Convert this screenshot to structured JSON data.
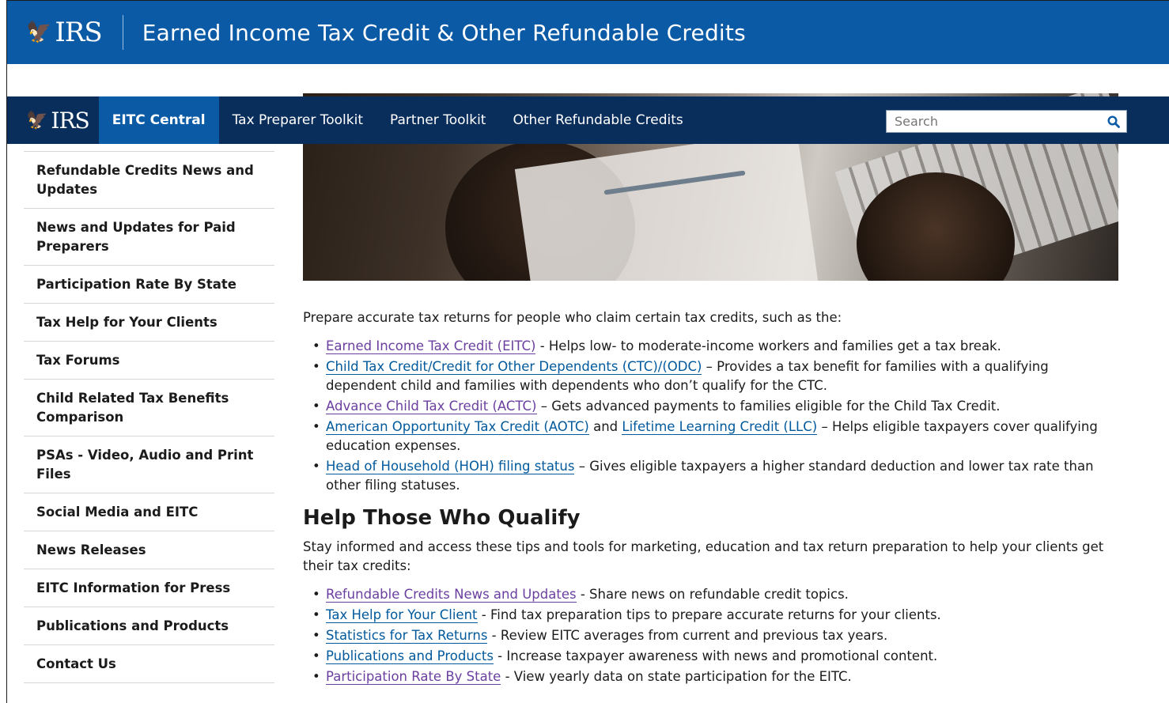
{
  "banner": {
    "logo_text": "IRS",
    "title": "Earned Income Tax Credit & Other Refundable Credits"
  },
  "nav": {
    "logo_text": "IRS",
    "items": [
      {
        "label": "EITC Central",
        "active": true
      },
      {
        "label": "Tax Preparer Toolkit",
        "active": false
      },
      {
        "label": "Partner Toolkit",
        "active": false
      },
      {
        "label": "Other Refundable Credits",
        "active": false
      }
    ],
    "search_placeholder": "Search"
  },
  "sidebar": {
    "items": [
      {
        "label": "Refundable Credits News and Updates"
      },
      {
        "label": "News and Updates for Paid Preparers"
      },
      {
        "label": "Participation Rate By State"
      },
      {
        "label": "Tax Help for Your Clients"
      },
      {
        "label": "Tax Forums"
      },
      {
        "label": "Child Related Tax Benefits Comparison"
      },
      {
        "label": "PSAs - Video, Audio and Print Files"
      },
      {
        "label": "Social Media and EITC"
      },
      {
        "label": "News Releases"
      },
      {
        "label": "EITC Information for Press"
      },
      {
        "label": "Publications and Products"
      },
      {
        "label": "Contact Us"
      }
    ]
  },
  "main": {
    "intro": "Prepare accurate tax returns for people who claim certain tax credits, such as the:",
    "credits": [
      {
        "link": "Earned Income Tax Credit (EITC)",
        "text": " - Helps low- to moderate-income workers and families get a tax break."
      },
      {
        "link": "Child Tax Credit/Credit for Other Dependents (CTC)/(ODC)",
        "text": " – Provides a tax benefit for families with a qualifying dependent child and families with dependents who don’t qualify for the CTC."
      },
      {
        "link": "Advance Child Tax Credit (ACTC)",
        "text": " – Gets advanced payments to families eligible for the Child Tax Credit."
      },
      {
        "link": "American Opportunity Tax Credit (AOTC)",
        "middle": " and ",
        "link2": "Lifetime Learning Credit (LLC)",
        "text": "  – Helps eligible taxpayers cover qualifying education expenses."
      },
      {
        "link": "Head of Household (HOH) filing status",
        "text": " – Gives eligible taxpayers a higher standard deduction and lower tax rate than other filing statuses."
      }
    ],
    "heading": "Help Those Who Qualify",
    "help_intro": "Stay informed and access these tips and tools for marketing, education and tax return preparation to help your clients get their tax credits:",
    "tools": [
      {
        "link": "Refundable Credits News and Updates",
        "text": " - Share news on refundable credit topics."
      },
      {
        "link": "Tax Help for Your Client",
        "text": " - Find tax preparation tips to prepare accurate returns for your clients."
      },
      {
        "link": "Statistics for Tax Returns",
        "text": " - Review EITC averages from current and previous tax years."
      },
      {
        "link": "Publications and Products",
        "text": " - Increase taxpayer awareness with news and promotional content."
      },
      {
        "link": "Participation Rate By State",
        "text": " - View yearly data on state participation for the EITC."
      }
    ]
  },
  "colors": {
    "banner_blue": "#0b5aa6",
    "nav_navy": "#0a2e5c",
    "link_blue": "#00599c",
    "link_visited": "#6b3fa0"
  }
}
